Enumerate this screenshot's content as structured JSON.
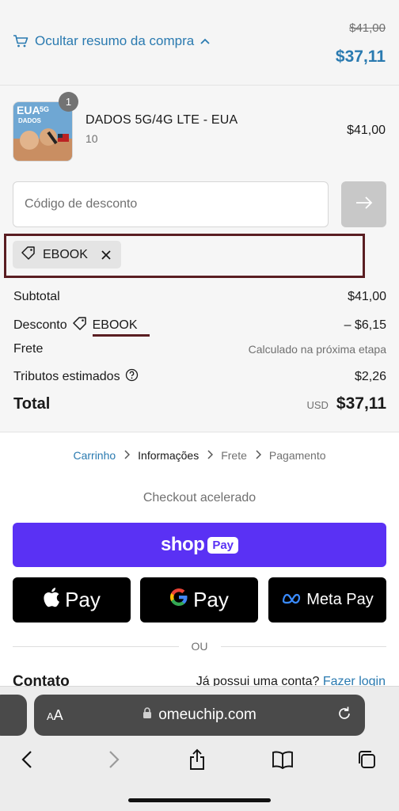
{
  "summary_toggle": {
    "label": "Ocultar resumo da compra",
    "original_price": "$41,00",
    "current_price": "$37,11"
  },
  "product": {
    "quantity": "1",
    "name": "DADOS 5G/4G LTE - EUA",
    "variant": "10",
    "price": "$41,00",
    "thumb_text_line1": "EUA",
    "thumb_text_5g": "5G",
    "thumb_text_line2": "DADOS"
  },
  "discount": {
    "placeholder": "Código de desconto",
    "applied_code": "EBOOK"
  },
  "totals": {
    "subtotal_label": "Subtotal",
    "subtotal_value": "$41,00",
    "discount_label": "Desconto",
    "discount_code": "EBOOK",
    "discount_value": "– $6,15",
    "shipping_label": "Frete",
    "shipping_value": "Calculado na próxima etapa",
    "taxes_label": "Tributos estimados",
    "taxes_value": "$2,26",
    "total_label": "Total",
    "total_currency": "USD",
    "total_value": "$37,11"
  },
  "breadcrumb": {
    "cart": "Carrinho",
    "information": "Informações",
    "shipping": "Frete",
    "payment": "Pagamento"
  },
  "express": {
    "title": "Checkout acelerado",
    "shop_word": "shop",
    "shop_pay": "Pay",
    "apple_pay": "Pay",
    "google_pay": "Pay",
    "meta_pay": "Meta Pay",
    "or": "OU"
  },
  "contact": {
    "title": "Contato",
    "account_question": "Já possui uma conta?",
    "login_link": "Fazer login"
  },
  "browser": {
    "aa_small": "A",
    "aa_large": "A",
    "url": "omeuchip.com"
  },
  "colors": {
    "accent": "#2a7ab0",
    "shop_pay": "#5a31f4",
    "highlight": "#5a1e22"
  }
}
